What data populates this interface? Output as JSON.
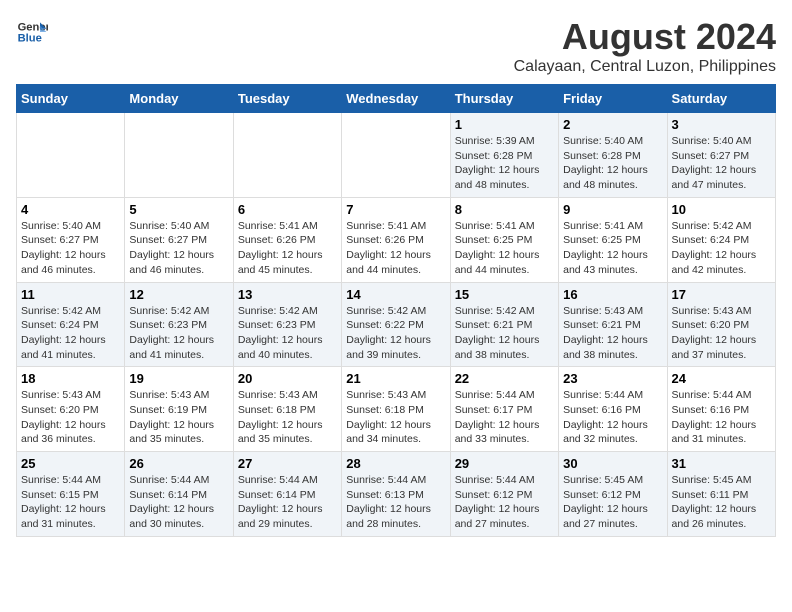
{
  "logo": {
    "line1": "General",
    "line2": "Blue"
  },
  "title": "August 2024",
  "subtitle": "Calayaan, Central Luzon, Philippines",
  "days_of_week": [
    "Sunday",
    "Monday",
    "Tuesday",
    "Wednesday",
    "Thursday",
    "Friday",
    "Saturday"
  ],
  "weeks": [
    [
      {
        "day": "",
        "info": ""
      },
      {
        "day": "",
        "info": ""
      },
      {
        "day": "",
        "info": ""
      },
      {
        "day": "",
        "info": ""
      },
      {
        "day": "1",
        "info": "Sunrise: 5:39 AM\nSunset: 6:28 PM\nDaylight: 12 hours\nand 48 minutes."
      },
      {
        "day": "2",
        "info": "Sunrise: 5:40 AM\nSunset: 6:28 PM\nDaylight: 12 hours\nand 48 minutes."
      },
      {
        "day": "3",
        "info": "Sunrise: 5:40 AM\nSunset: 6:27 PM\nDaylight: 12 hours\nand 47 minutes."
      }
    ],
    [
      {
        "day": "4",
        "info": "Sunrise: 5:40 AM\nSunset: 6:27 PM\nDaylight: 12 hours\nand 46 minutes."
      },
      {
        "day": "5",
        "info": "Sunrise: 5:40 AM\nSunset: 6:27 PM\nDaylight: 12 hours\nand 46 minutes."
      },
      {
        "day": "6",
        "info": "Sunrise: 5:41 AM\nSunset: 6:26 PM\nDaylight: 12 hours\nand 45 minutes."
      },
      {
        "day": "7",
        "info": "Sunrise: 5:41 AM\nSunset: 6:26 PM\nDaylight: 12 hours\nand 44 minutes."
      },
      {
        "day": "8",
        "info": "Sunrise: 5:41 AM\nSunset: 6:25 PM\nDaylight: 12 hours\nand 44 minutes."
      },
      {
        "day": "9",
        "info": "Sunrise: 5:41 AM\nSunset: 6:25 PM\nDaylight: 12 hours\nand 43 minutes."
      },
      {
        "day": "10",
        "info": "Sunrise: 5:42 AM\nSunset: 6:24 PM\nDaylight: 12 hours\nand 42 minutes."
      }
    ],
    [
      {
        "day": "11",
        "info": "Sunrise: 5:42 AM\nSunset: 6:24 PM\nDaylight: 12 hours\nand 41 minutes."
      },
      {
        "day": "12",
        "info": "Sunrise: 5:42 AM\nSunset: 6:23 PM\nDaylight: 12 hours\nand 41 minutes."
      },
      {
        "day": "13",
        "info": "Sunrise: 5:42 AM\nSunset: 6:23 PM\nDaylight: 12 hours\nand 40 minutes."
      },
      {
        "day": "14",
        "info": "Sunrise: 5:42 AM\nSunset: 6:22 PM\nDaylight: 12 hours\nand 39 minutes."
      },
      {
        "day": "15",
        "info": "Sunrise: 5:42 AM\nSunset: 6:21 PM\nDaylight: 12 hours\nand 38 minutes."
      },
      {
        "day": "16",
        "info": "Sunrise: 5:43 AM\nSunset: 6:21 PM\nDaylight: 12 hours\nand 38 minutes."
      },
      {
        "day": "17",
        "info": "Sunrise: 5:43 AM\nSunset: 6:20 PM\nDaylight: 12 hours\nand 37 minutes."
      }
    ],
    [
      {
        "day": "18",
        "info": "Sunrise: 5:43 AM\nSunset: 6:20 PM\nDaylight: 12 hours\nand 36 minutes."
      },
      {
        "day": "19",
        "info": "Sunrise: 5:43 AM\nSunset: 6:19 PM\nDaylight: 12 hours\nand 35 minutes."
      },
      {
        "day": "20",
        "info": "Sunrise: 5:43 AM\nSunset: 6:18 PM\nDaylight: 12 hours\nand 35 minutes."
      },
      {
        "day": "21",
        "info": "Sunrise: 5:43 AM\nSunset: 6:18 PM\nDaylight: 12 hours\nand 34 minutes."
      },
      {
        "day": "22",
        "info": "Sunrise: 5:44 AM\nSunset: 6:17 PM\nDaylight: 12 hours\nand 33 minutes."
      },
      {
        "day": "23",
        "info": "Sunrise: 5:44 AM\nSunset: 6:16 PM\nDaylight: 12 hours\nand 32 minutes."
      },
      {
        "day": "24",
        "info": "Sunrise: 5:44 AM\nSunset: 6:16 PM\nDaylight: 12 hours\nand 31 minutes."
      }
    ],
    [
      {
        "day": "25",
        "info": "Sunrise: 5:44 AM\nSunset: 6:15 PM\nDaylight: 12 hours\nand 31 minutes."
      },
      {
        "day": "26",
        "info": "Sunrise: 5:44 AM\nSunset: 6:14 PM\nDaylight: 12 hours\nand 30 minutes."
      },
      {
        "day": "27",
        "info": "Sunrise: 5:44 AM\nSunset: 6:14 PM\nDaylight: 12 hours\nand 29 minutes."
      },
      {
        "day": "28",
        "info": "Sunrise: 5:44 AM\nSunset: 6:13 PM\nDaylight: 12 hours\nand 28 minutes."
      },
      {
        "day": "29",
        "info": "Sunrise: 5:44 AM\nSunset: 6:12 PM\nDaylight: 12 hours\nand 27 minutes."
      },
      {
        "day": "30",
        "info": "Sunrise: 5:45 AM\nSunset: 6:12 PM\nDaylight: 12 hours\nand 27 minutes."
      },
      {
        "day": "31",
        "info": "Sunrise: 5:45 AM\nSunset: 6:11 PM\nDaylight: 12 hours\nand 26 minutes."
      }
    ]
  ]
}
